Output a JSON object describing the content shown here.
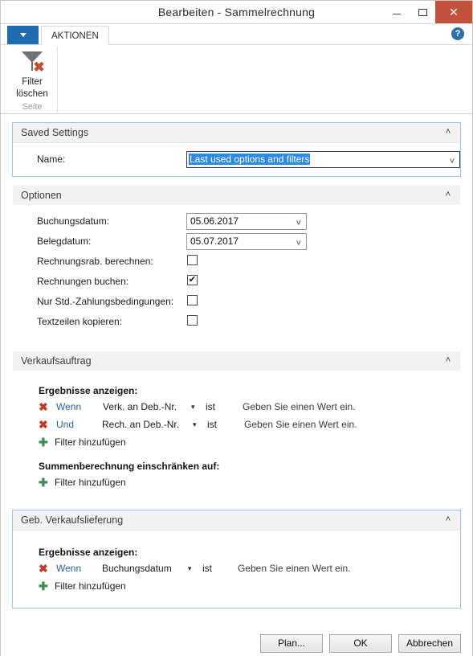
{
  "window": {
    "title": "Bearbeiten - Sammelrechnung",
    "minimize_glyph": "minimize-icon",
    "maximize_glyph": "maximize-icon",
    "close_glyph": "✕"
  },
  "ribbon": {
    "file_menu_label": "",
    "tab_label": "AKTIONEN",
    "help_label": "?",
    "group": {
      "button_line1": "Filter",
      "button_line2": "löschen",
      "group_label": "Seite"
    }
  },
  "saved_settings": {
    "header": "Saved Settings",
    "chevron": "˄",
    "name_label": "Name:",
    "name_value": "Last used options and filters"
  },
  "optionen": {
    "header": "Optionen",
    "chevron": "˄",
    "rows": [
      {
        "label": "Buchungsdatum:",
        "type": "combo",
        "value": "05.06.2017"
      },
      {
        "label": "Belegdatum:",
        "type": "combo",
        "value": "05.07.2017"
      },
      {
        "label": "Rechnungsrab. berechnen:",
        "type": "check",
        "checked": false,
        "mark": ""
      },
      {
        "label": "Rechnungen buchen:",
        "type": "check",
        "checked": true,
        "mark": "✔"
      },
      {
        "label": "Nur Std.-Zahlungsbedingungen:",
        "type": "check",
        "checked": false,
        "mark": ""
      },
      {
        "label": "Textzeilen kopieren:",
        "type": "check",
        "checked": false,
        "mark": ""
      }
    ]
  },
  "verkaufsauftrag": {
    "header": "Verkaufsauftrag",
    "chevron": "˄",
    "results_heading": "Ergebnisse anzeigen:",
    "filters": [
      {
        "remove_icon": "✖",
        "conjunction": "Wenn",
        "field": "Verk. an Deb.-Nr.",
        "caret": "▾",
        "operator": "ist",
        "value": "Geben Sie einen Wert ein."
      },
      {
        "remove_icon": "✖",
        "conjunction": "Und",
        "field": "Rech. an Deb.-Nr.",
        "caret": "▾",
        "operator": "ist",
        "value": "Geben Sie einen Wert ein."
      }
    ],
    "add_filter_label": "Filter hinzufügen",
    "add_icon": "✚",
    "totals_heading": "Summenberechnung einschränken auf:",
    "totals_add_filter_label": "Filter hinzufügen",
    "totals_add_icon": "✚"
  },
  "geb_verkaufslieferung": {
    "header": "Geb. Verkaufslieferung",
    "chevron": "˄",
    "results_heading": "Ergebnisse anzeigen:",
    "filters": [
      {
        "remove_icon": "✖",
        "conjunction": "Wenn",
        "field": "Buchungsdatum",
        "caret": "▾",
        "operator": "ist",
        "value": "Geben Sie einen Wert ein."
      }
    ],
    "add_filter_label": "Filter hinzufügen",
    "add_icon": "✚"
  },
  "footer": {
    "plan_label": "Plan...",
    "ok_label": "OK",
    "cancel_label": "Abbrechen"
  },
  "colors": {
    "accent_blue": "#1f6cb0",
    "close_red": "#c2523c",
    "selection_blue": "#2a8ae8",
    "link_blue": "#2a6099",
    "remove_red": "#c0392b",
    "add_green": "#3f8a52",
    "panel_header_bg": "#f2f2f2",
    "focus_border": "#9dc4e6"
  }
}
